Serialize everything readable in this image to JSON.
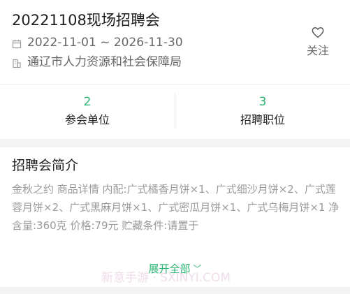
{
  "header": {
    "title": "20221108现场招聘会",
    "date_range": "2022-11-01 ~ 2026-11-30",
    "organizer": "通辽市人力资源和社会保障局",
    "follow_label": "关注"
  },
  "stats": {
    "units": {
      "count": "2",
      "label": "参会单位"
    },
    "positions": {
      "count": "3",
      "label": "招聘职位"
    }
  },
  "intro": {
    "title": "招聘会简介",
    "text": "金秋之约 商品详情 内配:广式橘香月饼×1、广式细沙月饼×2、广式莲蓉月饼×2、广式黑麻月饼×1、广式密瓜月饼×1、广式乌梅月饼×1 净含量:360克 价格:79元 贮藏条件:请置于",
    "expand_label": "展开全部"
  },
  "watermark": "新意手游 · SXINYI.COM",
  "colors": {
    "accent": "#2bb673",
    "muted_text": "#9a9a9a",
    "section_gap": "#f3f3f3"
  },
  "icons": {
    "date": "calendar-icon",
    "organizer": "building-icon",
    "follow": "heart-icon",
    "expand": "chevron-down-icon"
  }
}
